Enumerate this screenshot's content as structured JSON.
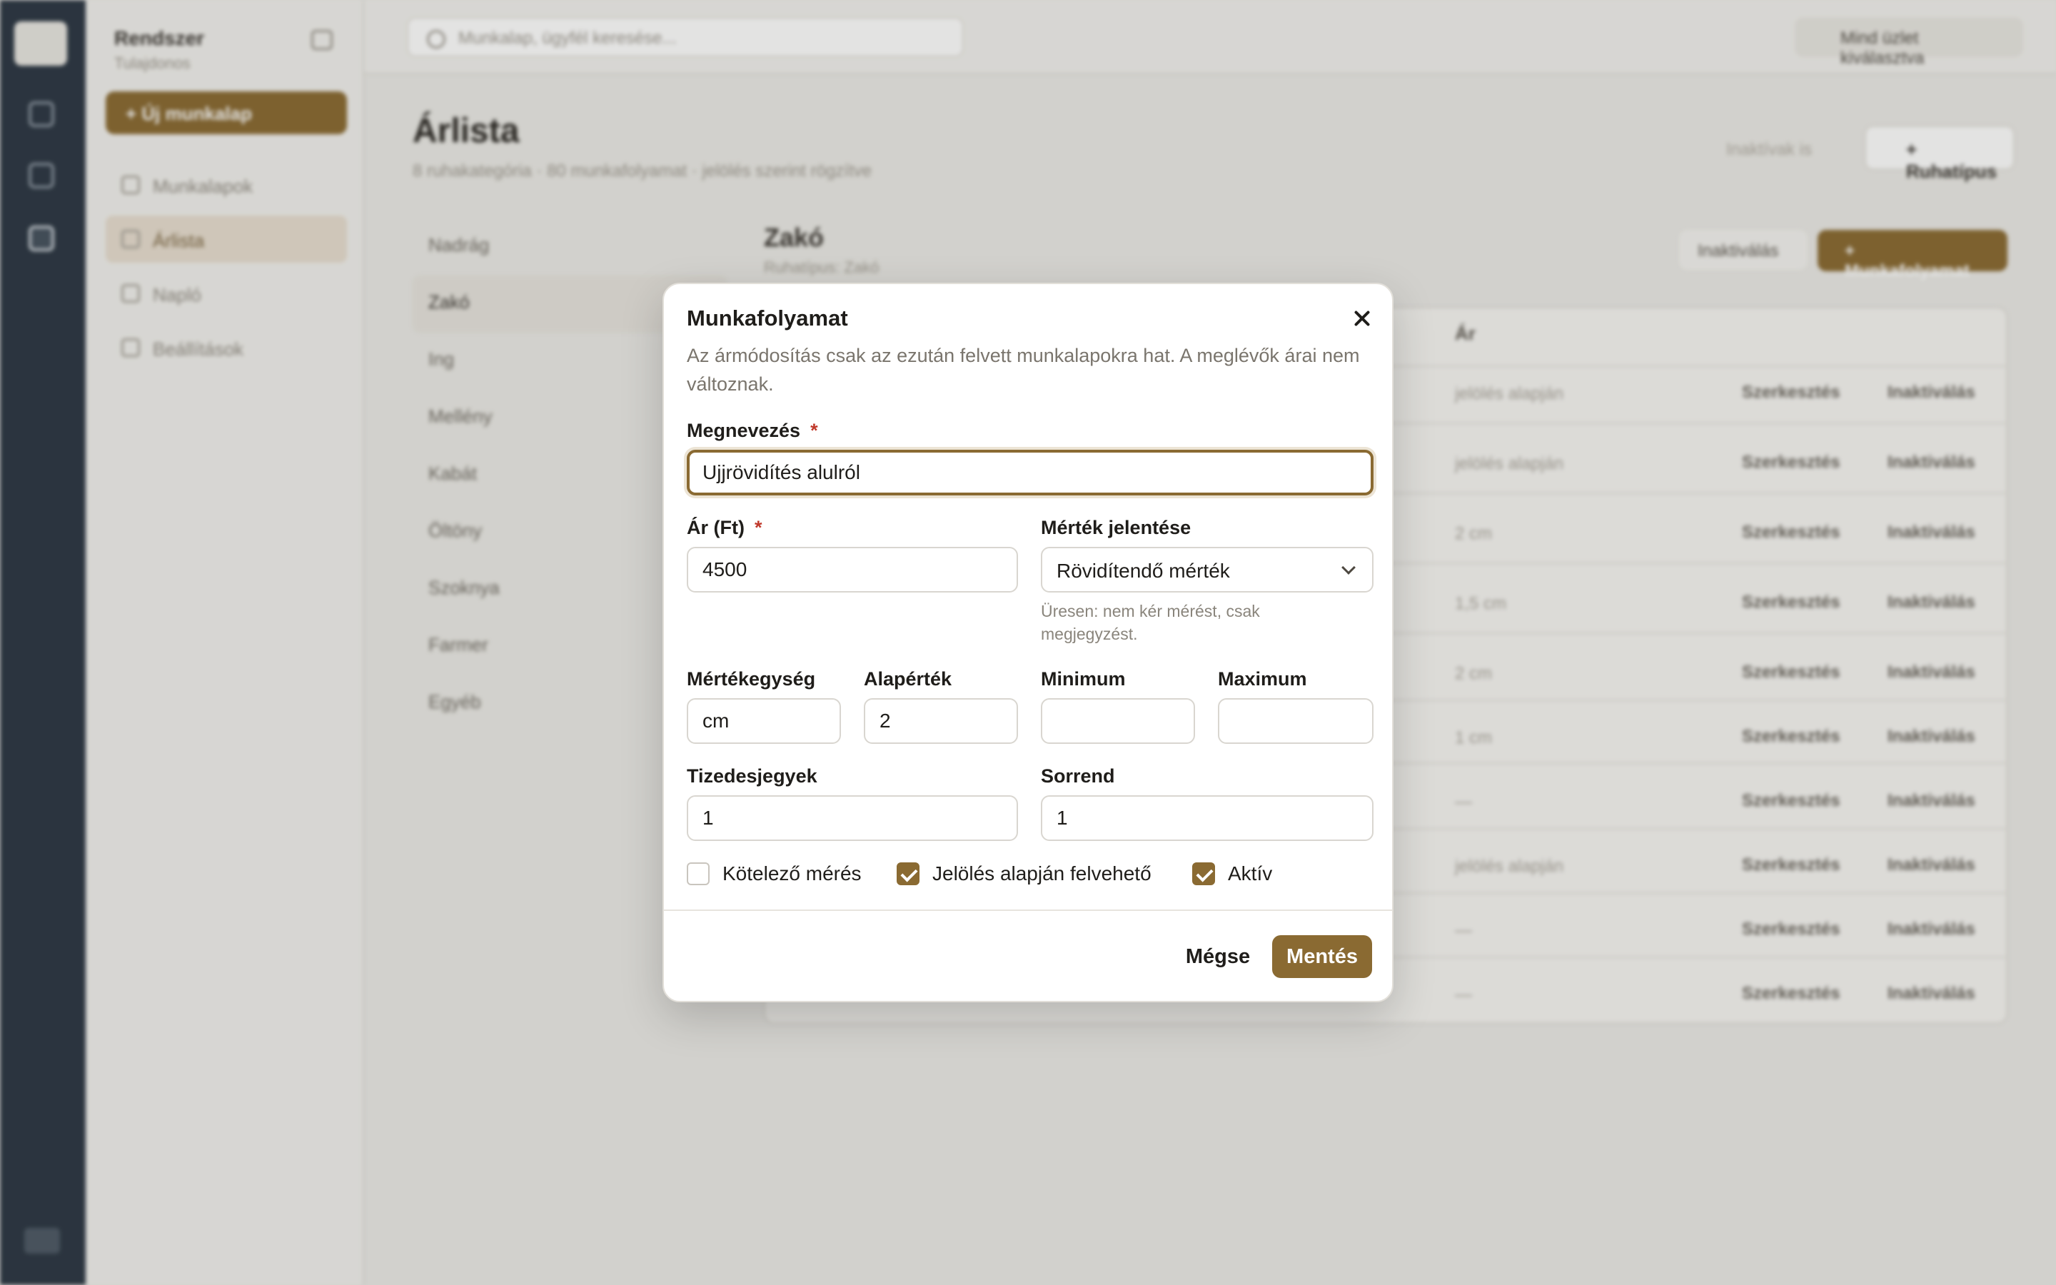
{
  "sidebar": {
    "brand": "Rendszer",
    "brand_sub": "Tulajdonos",
    "new_button": "+ Új munkalap",
    "items": [
      {
        "label": "Munkalapok"
      },
      {
        "label": "Árlista"
      },
      {
        "label": "Napló"
      },
      {
        "label": "Beállítások"
      }
    ]
  },
  "topbar": {
    "search_placeholder": "Munkalap, ügyfél keresése...",
    "shop_label": "Mind üzlet kiválasztva"
  },
  "page": {
    "title": "Árlista",
    "subtitle": "8 ruhakategória · 80 munkafolyamat · jelölés szerint rögzítve",
    "archive_button": "Inaktívak is",
    "category_button": "+ Ruhatípus"
  },
  "categories": [
    "Nadrág",
    "Zakó",
    "Ing",
    "Mellény",
    "Kabát",
    "Öltöny",
    "Szoknya",
    "Farmer",
    "Egyéb"
  ],
  "panel": {
    "title": "Zakó",
    "subtitle": "Ruhatípus: Zakó",
    "deactivate_button": "Inaktiválás",
    "new_workflow_button": "+ Munkafolyamat",
    "price_header": "Ár",
    "rows": [
      {
        "price": "jelölés alapján"
      },
      {
        "price": "jelölés alapján"
      },
      {
        "price": "2 cm"
      },
      {
        "price": "1,5 cm"
      },
      {
        "price": "2 cm"
      },
      {
        "price": "1 cm"
      },
      {
        "price": "—"
      },
      {
        "price": "jelölés alapján"
      },
      {
        "price": "—"
      },
      {
        "price": "—"
      }
    ],
    "edit_label": "Szerkesztés",
    "deact_label": "Inaktiválás"
  },
  "modal": {
    "title": "Munkafolyamat",
    "description": "Az ármódosítás csak az ezután felvett munkalapokra hat. A meglévők árai nem változnak.",
    "name_label": "Megnevezés",
    "name_value": "Ujjrövidítés alulról",
    "price_label": "Ár (Ft)",
    "price_value": "4500",
    "measure_meaning_label": "Mérték jelentése",
    "measure_meaning_value": "Rövidítendő mérték",
    "measure_hint": "Üresen: nem kér mérést, csak megjegyzést.",
    "unit_label": "Mértékegység",
    "unit_value": "cm",
    "default_label": "Alapérték",
    "default_value": "2",
    "min_label": "Minimum",
    "min_value": "",
    "max_label": "Maximum",
    "max_value": "",
    "decimals_label": "Tizedesjegyek",
    "decimals_value": "1",
    "order_label": "Sorrend",
    "order_value": "1",
    "required_star": "*",
    "checkboxes": [
      {
        "label": "Kötelező mérés",
        "checked": false
      },
      {
        "label": "Jelölés alapján felvehető",
        "checked": true
      },
      {
        "label": "Aktív",
        "checked": true
      }
    ],
    "cancel_button": "Mégse",
    "save_button": "Mentés"
  },
  "colors": {
    "accent": "#8a6a32",
    "required": "#c0392b",
    "rail": "#2c3744"
  }
}
